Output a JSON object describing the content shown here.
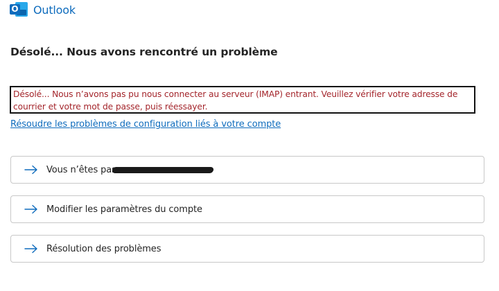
{
  "header": {
    "app_title": "Outlook",
    "logo_letter": "O",
    "brand_color": "#0f6cbd"
  },
  "error": {
    "title": "Désolé... Nous avons rencontré un problème",
    "message": "Désolé... Nous n’avons pas pu nous connecter au serveur (IMAP) entrant. Veuillez vérifier votre adresse de courrier et votre mot de passe, puis réessayer.",
    "message_color": "#a4262c",
    "help_link": "Résoudre les problèmes de configuration liés à votre compte"
  },
  "actions": [
    {
      "label": "Vous n’êtes pas",
      "icon": "arrow-right-icon"
    },
    {
      "label": "Modifier les paramètres du compte",
      "icon": "arrow-right-icon"
    },
    {
      "label": "Résolution des problèmes",
      "icon": "arrow-right-icon"
    }
  ]
}
